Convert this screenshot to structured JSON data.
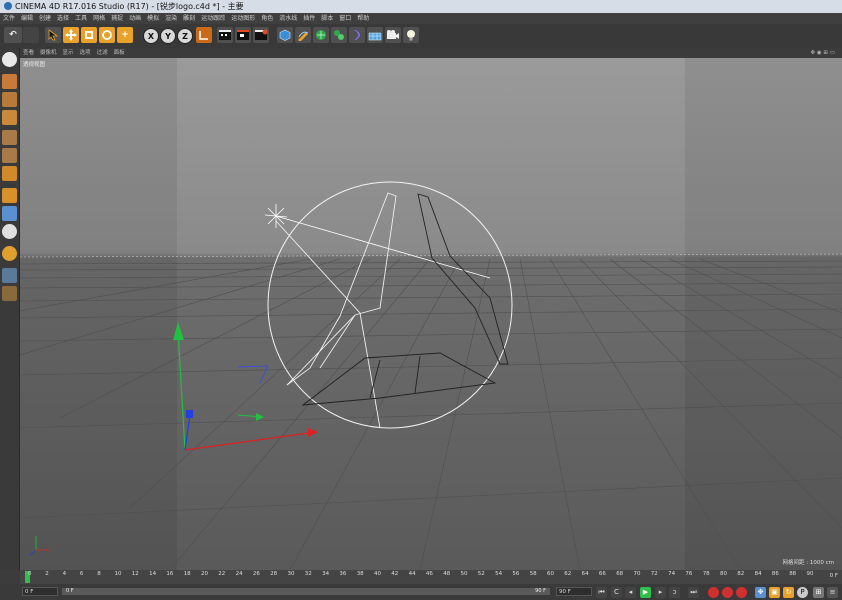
{
  "window": {
    "title": "CINEMA 4D R17.016 Studio (R17) - [锐步logo.c4d *] - 主要"
  },
  "menu": [
    "文件",
    "编辑",
    "创建",
    "选择",
    "工具",
    "网格",
    "捕捉",
    "动画",
    "模拟",
    "渲染",
    "雕刻",
    "运动跟踪",
    "运动图形",
    "角色",
    "流水线",
    "插件",
    "脚本",
    "窗口",
    "帮助"
  ],
  "toolbar": {
    "axis_x": "X",
    "axis_y": "Y",
    "axis_z": "Z",
    "icons": [
      "undo-icon",
      "redo-icon",
      "select-cursor-icon",
      "move-icon",
      "scale-icon",
      "rotate-icon",
      "add-icon",
      "x-axis-icon",
      "y-axis-icon",
      "z-axis-icon",
      "coordinate-system-icon",
      "render-view-icon",
      "render-picture-queue-icon",
      "edit-render-settings-icon",
      "cube-icon",
      "pen-spline-icon",
      "subdivision-icon",
      "cloner-icon",
      "deformer-icon",
      "floor-icon",
      "camera-icon",
      "light-icon"
    ]
  },
  "viewport": {
    "menu": [
      "查看",
      "摄像机",
      "显示",
      "选项",
      "过滤",
      "面板"
    ],
    "label": "透视视图",
    "grid_scale": "网格间距 : 1000 cm"
  },
  "timeline": {
    "ticks": [
      "0",
      "2",
      "4",
      "6",
      "8",
      "10",
      "12",
      "14",
      "16",
      "18",
      "20",
      "22",
      "24",
      "26",
      "28",
      "30",
      "32",
      "34",
      "36",
      "38",
      "40",
      "42",
      "44",
      "46",
      "48",
      "50",
      "52",
      "54",
      "56",
      "58",
      "60",
      "62",
      "64",
      "66",
      "68",
      "70",
      "72",
      "74",
      "76",
      "78",
      "80",
      "82",
      "84",
      "86",
      "88",
      "90"
    ],
    "current_frame": "0 F"
  },
  "transport": {
    "start_field": "0 F",
    "range_start": "0 F",
    "range_end": "90 F",
    "end_field": "90 F"
  },
  "colors": {
    "accent": "#e8a22a",
    "x_axis": "#e02020",
    "y_axis": "#20c040",
    "z_axis": "#2040e0"
  }
}
